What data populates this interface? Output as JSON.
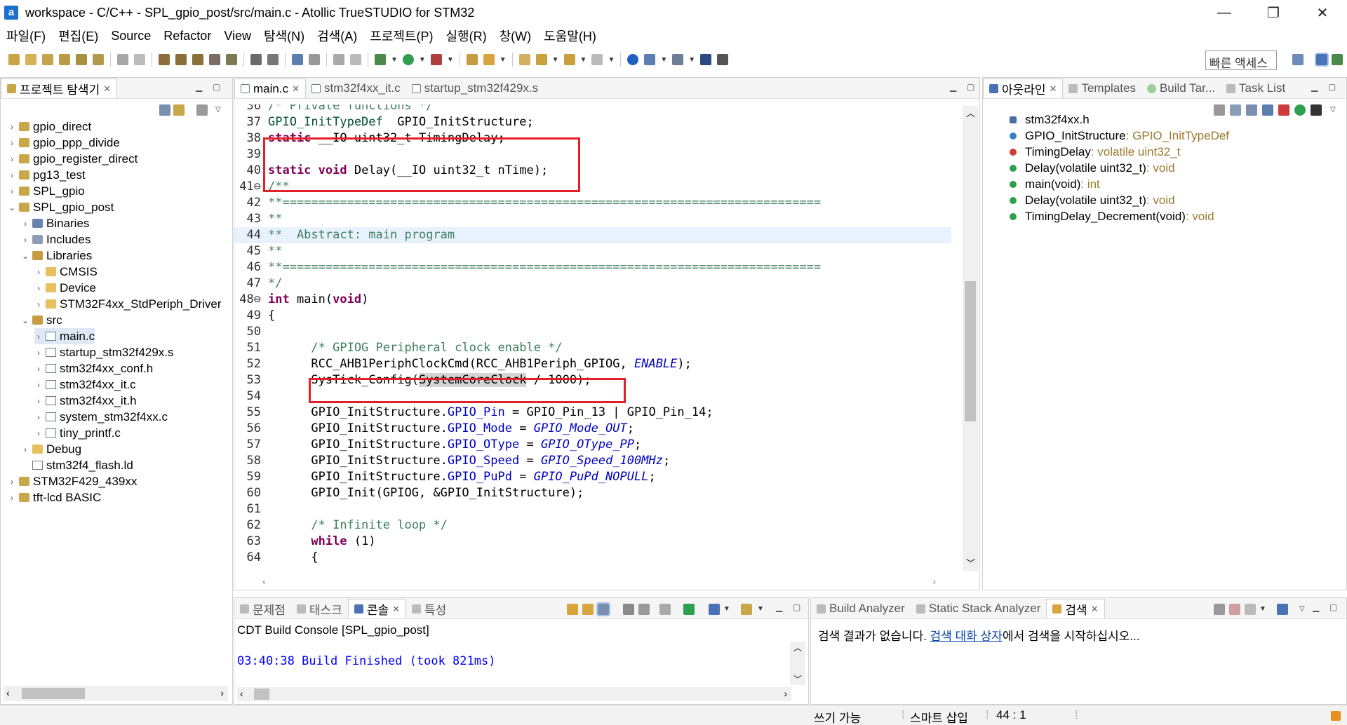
{
  "window": {
    "title": "workspace - C/C++ - SPL_gpio_post/src/main.c - Atollic TrueSTUDIO for STM32",
    "app_icon_letter": "a",
    "minimize": "—",
    "restore": "❐",
    "close": "✕"
  },
  "menu": [
    "파일(F)",
    "편집(E)",
    "Source",
    "Refactor",
    "View",
    "탐색(N)",
    "검색(A)",
    "프로젝트(P)",
    "실행(R)",
    "창(W)",
    "도움말(H)"
  ],
  "toolbar": {
    "quick_access": "빠른 액세스"
  },
  "explorer": {
    "tab_label": "프로젝트 탐색기",
    "items": [
      {
        "label": "gpio_direct",
        "level": 0,
        "twisty": "›",
        "icon": "project"
      },
      {
        "label": "gpio_ppp_divide",
        "level": 0,
        "twisty": "›",
        "icon": "project"
      },
      {
        "label": "gpio_register_direct",
        "level": 0,
        "twisty": "›",
        "icon": "project"
      },
      {
        "label": "pg13_test",
        "level": 0,
        "twisty": "›",
        "icon": "project"
      },
      {
        "label": "SPL_gpio",
        "level": 0,
        "twisty": "›",
        "icon": "project"
      },
      {
        "label": "SPL_gpio_post",
        "level": 0,
        "twisty": "⌄",
        "icon": "project"
      },
      {
        "label": "Binaries",
        "level": 1,
        "twisty": "›",
        "icon": "binaries"
      },
      {
        "label": "Includes",
        "level": 1,
        "twisty": "›",
        "icon": "includes"
      },
      {
        "label": "Libraries",
        "level": 1,
        "twisty": "⌄",
        "icon": "library"
      },
      {
        "label": "CMSIS",
        "level": 2,
        "twisty": "›",
        "icon": "folder"
      },
      {
        "label": "Device",
        "level": 2,
        "twisty": "›",
        "icon": "folder"
      },
      {
        "label": "STM32F4xx_StdPeriph_Driver",
        "level": 2,
        "twisty": "›",
        "icon": "folder"
      },
      {
        "label": "src",
        "level": 1,
        "twisty": "⌄",
        "icon": "library"
      },
      {
        "label": "main.c",
        "level": 2,
        "twisty": "›",
        "icon": "file",
        "selected": true
      },
      {
        "label": "startup_stm32f429x.s",
        "level": 2,
        "twisty": "›",
        "icon": "file"
      },
      {
        "label": "stm32f4xx_conf.h",
        "level": 2,
        "twisty": "›",
        "icon": "file"
      },
      {
        "label": "stm32f4xx_it.c",
        "level": 2,
        "twisty": "›",
        "icon": "file"
      },
      {
        "label": "stm32f4xx_it.h",
        "level": 2,
        "twisty": "›",
        "icon": "file"
      },
      {
        "label": "system_stm32f4xx.c",
        "level": 2,
        "twisty": "›",
        "icon": "file"
      },
      {
        "label": "tiny_printf.c",
        "level": 2,
        "twisty": "›",
        "icon": "file"
      },
      {
        "label": "Debug",
        "level": 1,
        "twisty": "›",
        "icon": "folder"
      },
      {
        "label": "stm32f4_flash.ld",
        "level": 1,
        "twisty": "",
        "icon": "file"
      },
      {
        "label": "STM32F429_439xx",
        "level": 0,
        "twisty": "›",
        "icon": "project"
      },
      {
        "label": "tft-lcd BASIC",
        "level": 0,
        "twisty": "›",
        "icon": "project"
      }
    ]
  },
  "editor": {
    "tabs": [
      {
        "label": "main.c",
        "active": true,
        "close": "✕"
      },
      {
        "label": "stm32f4xx_it.c",
        "active": false
      },
      {
        "label": "startup_stm32f429x.s",
        "active": false
      }
    ],
    "lines": [
      {
        "n": "36",
        "t": "/* Private functions */"
      },
      {
        "n": "37",
        "t": "GPIO_InitTypeDef  GPIO_InitStructure;"
      },
      {
        "n": "38",
        "t": "static __IO uint32_t TimingDelay;"
      },
      {
        "n": "39",
        "t": ""
      },
      {
        "n": "40",
        "t": "static void Delay(__IO uint32_t nTime);"
      },
      {
        "n": "41⊖",
        "t": "/**"
      },
      {
        "n": "42",
        "t": "**==========================================================================="
      },
      {
        "n": "43",
        "t": "**"
      },
      {
        "n": "44",
        "t": "**  Abstract: main program"
      },
      {
        "n": "45",
        "t": "**"
      },
      {
        "n": "46",
        "t": "**==========================================================================="
      },
      {
        "n": "47",
        "t": "*/"
      },
      {
        "n": "48⊖",
        "t": "int main(void)"
      },
      {
        "n": "49",
        "t": "{"
      },
      {
        "n": "50",
        "t": ""
      },
      {
        "n": "51",
        "t": "      /* GPIOG Peripheral clock enable */"
      },
      {
        "n": "52",
        "t": "      RCC_AHB1PeriphClockCmd(RCC_AHB1Periph_GPIOG, ENABLE);"
      },
      {
        "n": "53",
        "t": "      SysTick_Config(SystemCoreClock / 1000);"
      },
      {
        "n": "54",
        "t": ""
      },
      {
        "n": "55",
        "t": "      GPIO_InitStructure.GPIO_Pin = GPIO_Pin_13 | GPIO_Pin_14;"
      },
      {
        "n": "56",
        "t": "      GPIO_InitStructure.GPIO_Mode = GPIO_Mode_OUT;"
      },
      {
        "n": "57",
        "t": "      GPIO_InitStructure.GPIO_OType = GPIO_OType_PP;"
      },
      {
        "n": "58",
        "t": "      GPIO_InitStructure.GPIO_Speed = GPIO_Speed_100MHz;"
      },
      {
        "n": "59",
        "t": "      GPIO_InitStructure.GPIO_PuPd = GPIO_PuPd_NOPULL;"
      },
      {
        "n": "60",
        "t": "      GPIO_Init(GPIOG, &GPIO_InitStructure);"
      },
      {
        "n": "61",
        "t": ""
      },
      {
        "n": "62",
        "t": "      /* Infinite loop */"
      },
      {
        "n": "63",
        "t": "      while (1)"
      },
      {
        "n": "64",
        "t": "      {"
      }
    ]
  },
  "outline": {
    "tabs": [
      "아웃라인",
      "Templates",
      "Build Tar...",
      "Task List"
    ],
    "items": [
      {
        "name": "stm32f4xx.h",
        "type": "",
        "color": "#4a6da7"
      },
      {
        "name": "GPIO_InitStructure",
        "type": " : GPIO_InitTypeDef",
        "color": "#3a7fc4"
      },
      {
        "name": "TimingDelay",
        "type": " : volatile uint32_t",
        "color": "#cf3a3a"
      },
      {
        "name": "Delay(volatile uint32_t)",
        "type": " : void",
        "color": "#2e9e4f"
      },
      {
        "name": "main(void)",
        "type": " : int",
        "color": "#2e9e4f"
      },
      {
        "name": "Delay(volatile uint32_t)",
        "type": " : void",
        "color": "#2e9e4f"
      },
      {
        "name": "TimingDelay_Decrement(void)",
        "type": " : void",
        "color": "#2e9e4f"
      }
    ]
  },
  "console": {
    "tabs": [
      "문제점",
      "태스크",
      "콘솔",
      "특성"
    ],
    "active_tab": "콘솔",
    "title": "CDT Build Console [SPL_gpio_post]",
    "output": "03:40:38 Build Finished (took 821ms)"
  },
  "search": {
    "tabs": [
      "Build Analyzer",
      "Static Stack Analyzer",
      "검색"
    ],
    "msg_prefix": "검색 결과가 없습니다. ",
    "msg_link": "검색 대화 상자",
    "msg_suffix": "에서 검색을 시작하십시오..."
  },
  "status": {
    "writable": "쓰기 가능",
    "insert_mode": "스마트 삽입",
    "position": "44 : 1"
  },
  "colors": {
    "highlight_box": "#e0202a",
    "keyword": "#7f0055",
    "comment": "#3f7f5f",
    "field": "#0000c0",
    "console_output": "#0000ff"
  }
}
